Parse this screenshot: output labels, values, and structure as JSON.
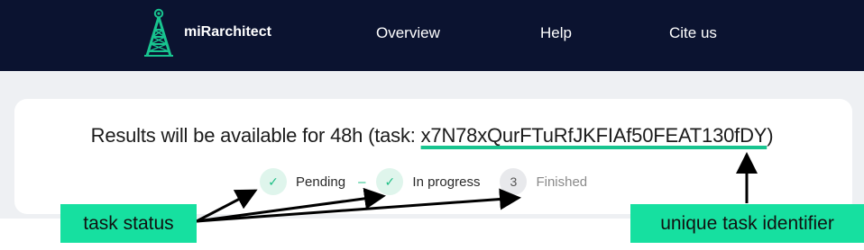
{
  "navbar": {
    "brand": "miRarchitect",
    "brand_logo_icon": "tower-logo-icon",
    "links": [
      "Overview",
      "Help",
      "Cite us"
    ]
  },
  "results": {
    "prefix": "Results will be available for 48h (task: ",
    "task_id": "x7N78xQurFTuRfJKFIAf50FEAT130fDY",
    "suffix": ")"
  },
  "steps": [
    {
      "icon": "checkmark-icon",
      "glyph": "✓",
      "label": "Pending",
      "state": "done"
    },
    {
      "icon": "checkmark-icon",
      "glyph": "✓",
      "label": "In progress",
      "state": "done"
    },
    {
      "icon": "step-number",
      "glyph": "3",
      "label": "Finished",
      "state": "pending"
    }
  ],
  "step_separator": "–",
  "annotations": {
    "task_status": "task status",
    "unique_task_identifier": "unique task identifier"
  },
  "colors": {
    "navbar_bg": "#0b1330",
    "accent": "#18c48f",
    "annotation_bg": "#16e0a0"
  }
}
